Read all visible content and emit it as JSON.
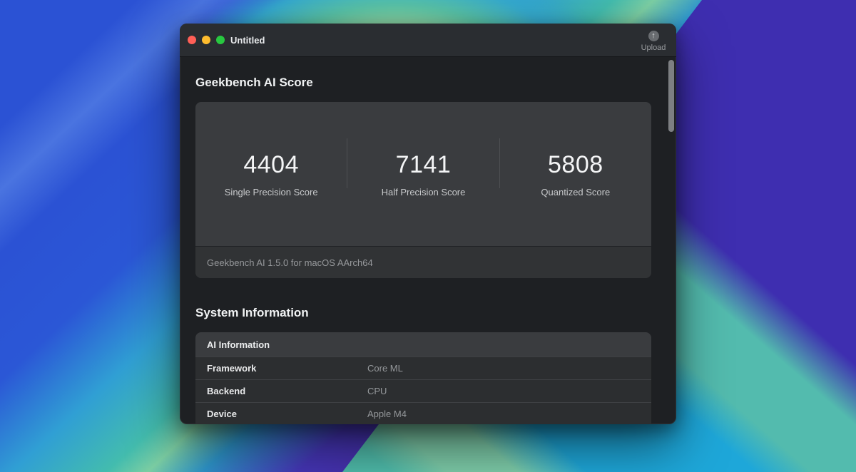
{
  "window": {
    "title": "Untitled",
    "upload_label": "Upload"
  },
  "icons": {
    "upload_glyph": "↑"
  },
  "score_section": {
    "heading": "Geekbench AI Score",
    "scores": [
      {
        "value": "4404",
        "label": "Single Precision Score"
      },
      {
        "value": "7141",
        "label": "Half Precision Score"
      },
      {
        "value": "5808",
        "label": "Quantized Score"
      }
    ],
    "footer": "Geekbench AI 1.5.0 for macOS AArch64"
  },
  "system_section": {
    "heading": "System Information",
    "table": {
      "header": "AI Information",
      "rows": [
        {
          "label": "Framework",
          "value": "Core ML"
        },
        {
          "label": "Backend",
          "value": "CPU"
        },
        {
          "label": "Device",
          "value": "Apple M4"
        }
      ]
    }
  },
  "colors": {
    "traffic_red": "#ff5f57",
    "traffic_yellow": "#febc2e",
    "traffic_green": "#28c840",
    "titlebar_bg": "#2a2d31",
    "window_bg": "#1e2023",
    "card_bg": "#3a3c3f",
    "value_text": "#95989b",
    "score_text": "#f4f5f6"
  }
}
